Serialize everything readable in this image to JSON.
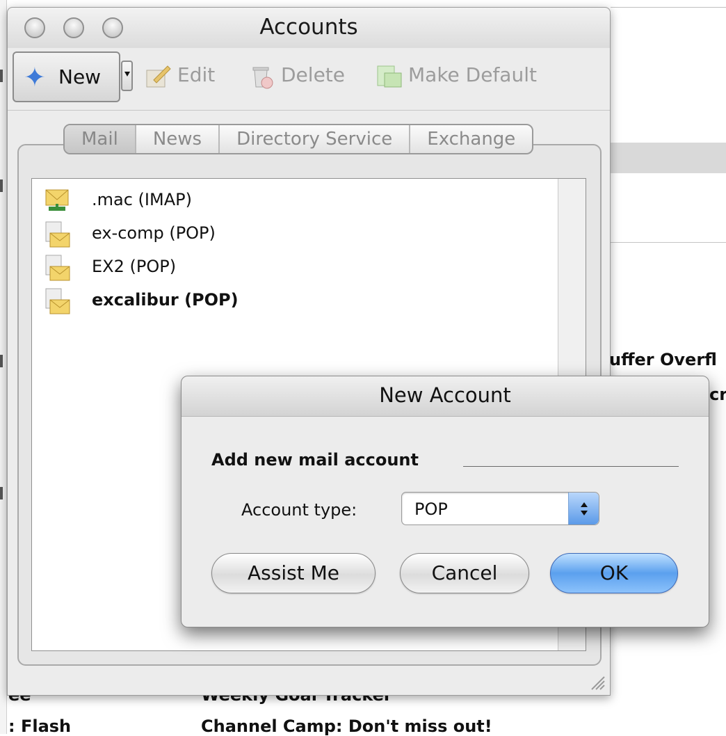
{
  "background_app": {
    "right_list_fragments": [
      "uffer Overfl",
      "cr"
    ],
    "bottom_rows": [
      {
        "left": "ee",
        "subject": "Weekly Goal Tracker"
      },
      {
        "left": ": Flash",
        "subject": "Channel Camp: Don't miss out!"
      }
    ]
  },
  "accounts_window": {
    "title": "Accounts",
    "traffic_lights": [
      "close-button",
      "minimize-button",
      "zoom-button"
    ],
    "toolbar": {
      "new_label": "New",
      "edit_label": "Edit",
      "delete_label": "Delete",
      "make_default_label": "Make Default"
    },
    "tabs": [
      {
        "label": "Mail",
        "selected": true
      },
      {
        "label": "News",
        "selected": false
      },
      {
        "label": "Directory Service",
        "selected": false
      },
      {
        "label": "Exchange",
        "selected": false
      }
    ],
    "accounts": [
      {
        "label": ".mac (IMAP)",
        "icon": "imap-account-icon",
        "bold": false
      },
      {
        "label": "ex-comp (POP)",
        "icon": "pop-account-icon",
        "bold": false
      },
      {
        "label": "EX2 (POP)",
        "icon": "pop-account-icon",
        "bold": false
      },
      {
        "label": "excalibur (POP)",
        "icon": "pop-account-icon",
        "bold": true
      }
    ]
  },
  "new_account_sheet": {
    "title": "New Account",
    "heading": "Add new mail account",
    "account_type_label": "Account type:",
    "account_type_value": "POP",
    "buttons": {
      "assist": "Assist Me",
      "cancel": "Cancel",
      "ok": "OK"
    }
  },
  "colors": {
    "default_button": "#5ba0ee",
    "stepper": "#5b9ae8",
    "window_bg": "#ececec"
  }
}
